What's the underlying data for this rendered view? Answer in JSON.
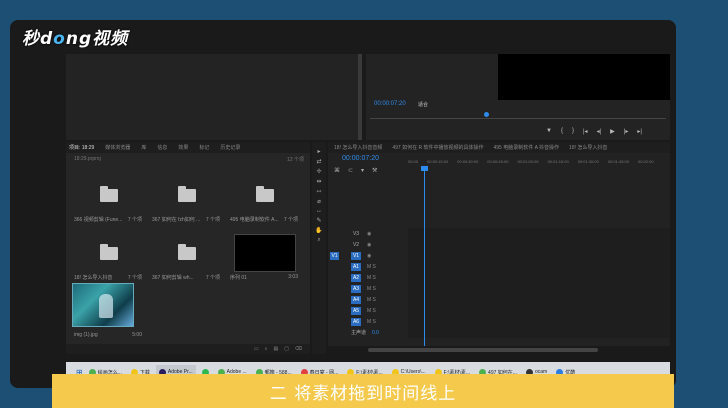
{
  "logo": {
    "text": "秒懂视频"
  },
  "program": {
    "timecode": "00:00:07:20",
    "fit_select": "适合",
    "transport": [
      "▼",
      "{",
      "}",
      "|◂",
      "◂|",
      "▶",
      "|▸",
      "▸|"
    ]
  },
  "project": {
    "tabs": [
      "项目: 18:29",
      "媒体浏览器",
      "库",
      "信息",
      "效果",
      "标记",
      "历史记录"
    ],
    "path": "18:29.prproj",
    "count": "12 个项",
    "items": [
      {
        "name": "366 视频剪辑 (Fune...",
        "count": "7 个项",
        "kind": "folder"
      },
      {
        "name": "367 如何在 fzh如何 ...",
        "count": "7 个项",
        "kind": "folder"
      },
      {
        "name": "495 电脑录制软件 A...",
        "count": "7 个项",
        "kind": "folder"
      },
      {
        "name": "18! 怎么导入抖音",
        "count": "7 个项",
        "kind": "folder"
      },
      {
        "name": "367 如何剪辑 wh...",
        "count": "7 个项",
        "kind": "folder"
      },
      {
        "name": "序列 01",
        "count": "3:03",
        "kind": "black"
      },
      {
        "name": "img (1).jpg",
        "count": "5:00",
        "kind": "image"
      }
    ]
  },
  "tools": [
    "▸",
    "⇄",
    "✢",
    "⇹",
    "⇿",
    "⌀",
    "↔",
    "✎",
    "✋",
    "⌕"
  ],
  "timeline": {
    "tabs": [
      "18! 怎么导入抖音音频",
      "497 如何在 R 软件中播放视频的具体操作",
      "495 电脑录制软件 A 抖音操作",
      "18! 怎么导入抖音"
    ],
    "timecode": "00:00:07:20",
    "ruler": [
      "00:00",
      "00:00:15:00",
      "00:00:30:00",
      "00:00:45:00",
      "00:01:00:00",
      "00:01:15:00",
      "00:01:30:00",
      "00:01:45:00",
      "00:02:00"
    ],
    "video_tracks": [
      "V3",
      "V2",
      "V1"
    ],
    "audio_tracks": [
      "A1",
      "A2",
      "A3",
      "A4",
      "A5",
      "A6"
    ],
    "master": "主声道",
    "master_value": "0.0"
  },
  "taskbar": {
    "items": [
      {
        "label": "绘画怎么...",
        "color": "#4caf50"
      },
      {
        "label": "下载",
        "color": "#f0c419"
      },
      {
        "label": "Adobe Pr...",
        "color": "#2a1a5e"
      },
      {
        "label": "",
        "color": "#2fb84f"
      },
      {
        "label": "Adobe ...",
        "color": "#4caf50"
      },
      {
        "label": "郵箱 - 588...",
        "color": "#4caf50"
      },
      {
        "label": "春日宴 - 网...",
        "color": "#e04040"
      },
      {
        "label": "F:\\素材\\素...",
        "color": "#f0c419"
      },
      {
        "label": "C:\\Users\\...",
        "color": "#f0c419"
      },
      {
        "label": "F:\\素材\\素...",
        "color": "#f0c419"
      },
      {
        "label": "497 如何在...",
        "color": "#4caf50"
      },
      {
        "label": "ocam",
        "color": "#333"
      },
      {
        "label": "优酷",
        "color": "#2a7de1"
      }
    ]
  },
  "caption": "二 将素材拖到时间线上",
  "colors": {
    "accent": "#2d8ceb",
    "caption_bg": "#f5c94c",
    "page_bg": "#1c4f73"
  }
}
